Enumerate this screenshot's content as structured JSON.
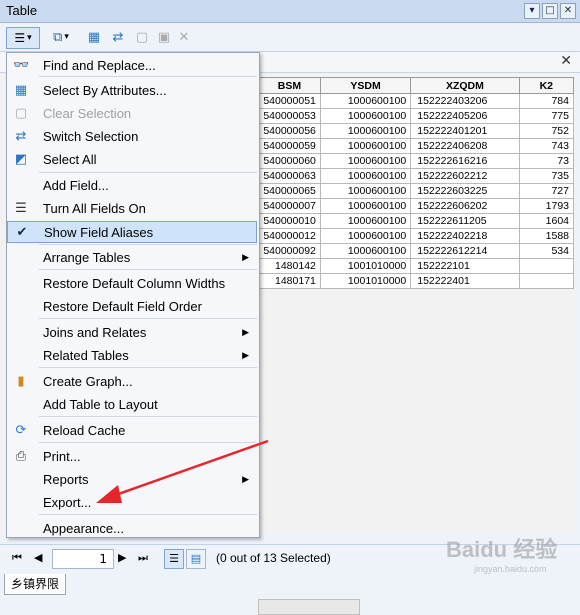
{
  "window": {
    "title": "Table"
  },
  "table": {
    "columns": [
      "BSM",
      "YSDM",
      "XZQDM",
      "K2"
    ],
    "rows": [
      [
        "540000051",
        "1000600100",
        "152222403206",
        "784"
      ],
      [
        "540000053",
        "1000600100",
        "152222405206",
        "775"
      ],
      [
        "540000056",
        "1000600100",
        "152222401201",
        "752"
      ],
      [
        "540000059",
        "1000600100",
        "152222406208",
        "743"
      ],
      [
        "540000060",
        "1000600100",
        "152222616216",
        "73"
      ],
      [
        "540000063",
        "1000600100",
        "152222602212",
        "735"
      ],
      [
        "540000065",
        "1000600100",
        "152222603225",
        "727"
      ],
      [
        "540000007",
        "1000600100",
        "152222606202",
        "1793"
      ],
      [
        "540000010",
        "1000600100",
        "152222611205",
        "1604"
      ],
      [
        "540000012",
        "1000600100",
        "152222402218",
        "1588"
      ],
      [
        "540000092",
        "1000600100",
        "152222612214",
        "534"
      ],
      [
        "1480142",
        "1001010000",
        "152222101",
        ""
      ],
      [
        "1480171",
        "1001010000",
        "152222401",
        ""
      ]
    ]
  },
  "menu": {
    "items": [
      {
        "label": "Find and Replace...",
        "icon": "binoculars-icon"
      },
      {
        "label": "Select By Attributes...",
        "icon": "select-attributes-icon"
      },
      {
        "label": "Clear Selection",
        "icon": "clear-selection-icon"
      },
      {
        "label": "Switch Selection",
        "icon": "switch-selection-icon"
      },
      {
        "label": "Select All",
        "icon": "select-all-icon"
      },
      {
        "label": "Add Field...",
        "icon": ""
      },
      {
        "label": "Turn All Fields On",
        "icon": "fields-list-icon"
      },
      {
        "label": "Show Field Aliases",
        "icon": "checkmark-icon"
      },
      {
        "label": "Arrange Tables",
        "icon": ""
      },
      {
        "label": "Restore Default Column Widths",
        "icon": ""
      },
      {
        "label": "Restore Default Field Order",
        "icon": ""
      },
      {
        "label": "Joins and Relates",
        "icon": ""
      },
      {
        "label": "Related Tables",
        "icon": ""
      },
      {
        "label": "Create Graph...",
        "icon": "bar-graph-icon"
      },
      {
        "label": "Add Table to Layout",
        "icon": ""
      },
      {
        "label": "Reload Cache",
        "icon": "reload-icon"
      },
      {
        "label": "Print...",
        "icon": "printer-icon"
      },
      {
        "label": "Reports",
        "icon": ""
      },
      {
        "label": "Export...",
        "icon": ""
      },
      {
        "label": "Appearance...",
        "icon": ""
      }
    ]
  },
  "status": {
    "record_number": "1",
    "selection_text": "(0 out of 13 Selected)"
  },
  "bottom_tab": {
    "label": "乡镇界限"
  },
  "watermark": {
    "text": "Baidu 经验",
    "url_text": "jingyan.baidu.com"
  },
  "colors": {
    "accent": "#cfe3fb",
    "annotation_arrow": "#e8262a"
  }
}
